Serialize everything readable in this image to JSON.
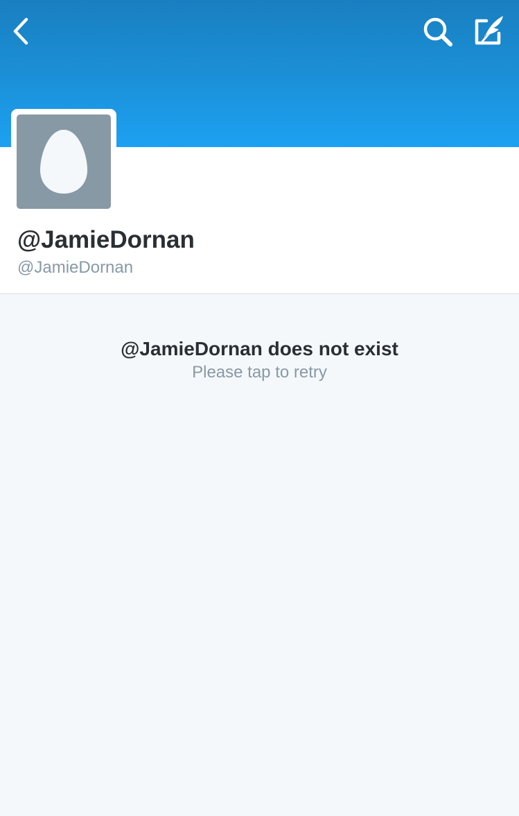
{
  "nav": {
    "back_icon": "chevron-left-icon",
    "search_icon": "search-icon",
    "compose_icon": "compose-tweet-icon"
  },
  "profile": {
    "avatar_icon": "default-egg-avatar",
    "display_name": "@JamieDornan",
    "screen_name": "@JamieDornan"
  },
  "error": {
    "title": "@JamieDornan does not exist",
    "subtitle": "Please tap to retry"
  },
  "colors": {
    "header_top": "#1a7fc1",
    "header_bottom": "#1da1f2",
    "avatar_bg": "#8899a6",
    "text_primary": "#292f33",
    "text_secondary": "#8899a6",
    "background": "#f5f8fa"
  }
}
